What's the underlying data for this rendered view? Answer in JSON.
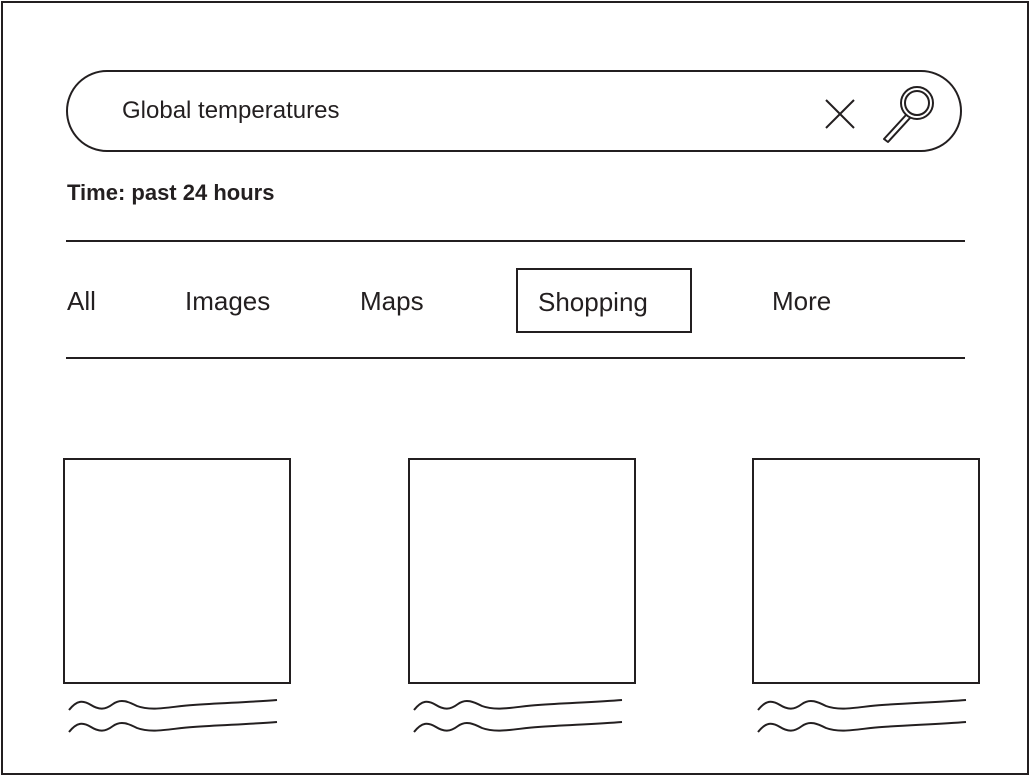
{
  "search": {
    "query": "Global temperatures",
    "clear_icon": "close-icon",
    "search_icon": "magnifier-icon"
  },
  "filter": {
    "time_label": "Time: past 24 hours"
  },
  "tabs": [
    {
      "label": "All",
      "selected": false
    },
    {
      "label": "Images",
      "selected": false
    },
    {
      "label": "Maps",
      "selected": false
    },
    {
      "label": "Shopping",
      "selected": true
    },
    {
      "label": "More",
      "selected": false
    }
  ],
  "results": [
    {
      "thumbnail": "placeholder-image",
      "caption": "placeholder-text-lines"
    },
    {
      "thumbnail": "placeholder-image",
      "caption": "placeholder-text-lines"
    },
    {
      "thumbnail": "placeholder-image",
      "caption": "placeholder-text-lines"
    }
  ],
  "colors": {
    "stroke": "#231f20",
    "background": "#ffffff"
  }
}
